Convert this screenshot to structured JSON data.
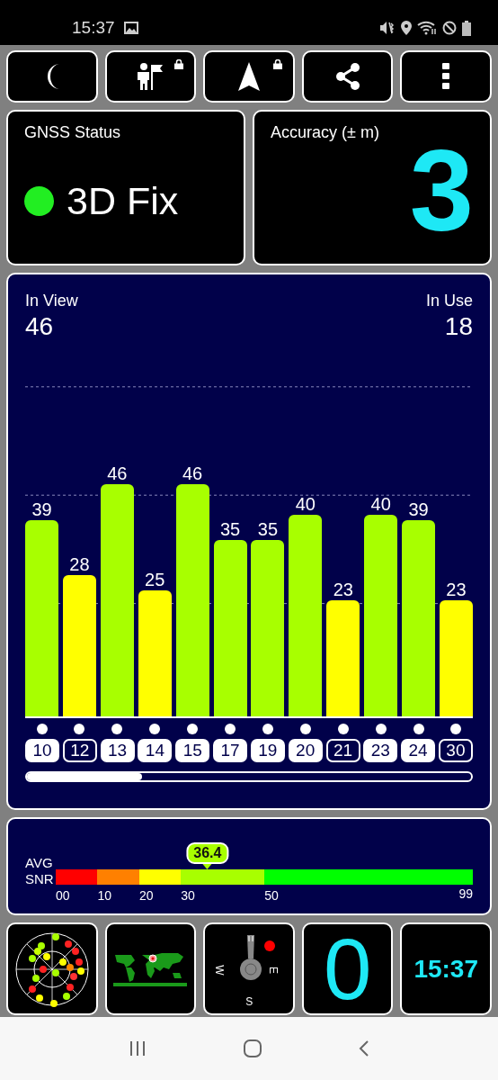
{
  "status_bar": {
    "time": "15:37"
  },
  "toolbar": {
    "buttons": [
      {
        "kind": "moon",
        "locked": false
      },
      {
        "kind": "person-flag",
        "locked": true
      },
      {
        "kind": "arrow",
        "locked": true
      },
      {
        "kind": "share",
        "locked": false
      },
      {
        "kind": "more",
        "locked": false
      }
    ]
  },
  "gnss_status": {
    "title": "GNSS Status",
    "fix": "3D Fix",
    "color": "#22ee22"
  },
  "accuracy": {
    "title": "Accuracy (± m)",
    "value": "3"
  },
  "signal_chart": {
    "in_view_label": "In View",
    "in_view": "46",
    "in_use_label": "In Use",
    "in_use": "18",
    "chart_data": {
      "type": "bar",
      "categories": [
        "10",
        "12",
        "13",
        "14",
        "15",
        "17",
        "19",
        "20",
        "21",
        "23",
        "24",
        "30"
      ],
      "series": [
        {
          "values": [
            39,
            28,
            46,
            25,
            46,
            35,
            35,
            40,
            23,
            40,
            39,
            23
          ]
        }
      ],
      "data_labels": true
    },
    "tags_used": [
      true,
      false,
      true,
      true,
      true,
      true,
      true,
      true,
      false,
      true,
      true,
      false
    ]
  },
  "snr_meter": {
    "label_top": "AVG",
    "label_bottom": "SNR",
    "value": "36.4",
    "segments": [
      {
        "label": "00",
        "color": "#ff0000"
      },
      {
        "label": "10",
        "color": "#ff8000"
      },
      {
        "label": "20",
        "color": "#ffff00"
      },
      {
        "label": "30",
        "color": "#a8ff00"
      },
      {
        "label": "50",
        "color": "#00ff00"
      }
    ],
    "end_label": "99"
  },
  "compass": {
    "west": "W",
    "east": "E",
    "south": "S"
  },
  "satellites_count": "0",
  "clock": "15:37"
}
